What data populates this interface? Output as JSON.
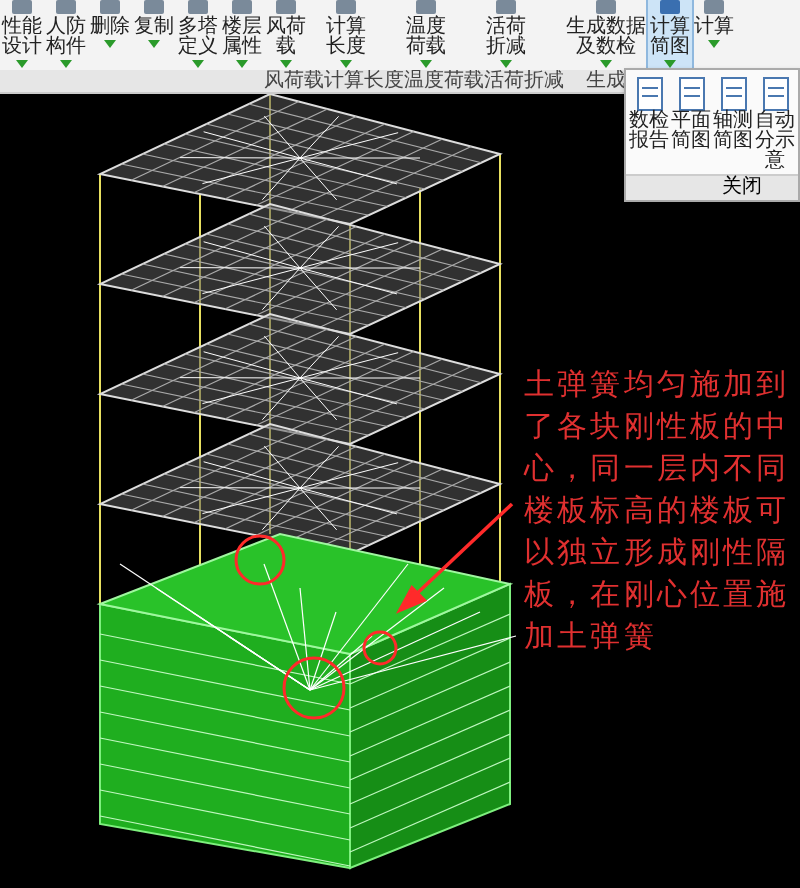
{
  "ribbon": {
    "groups": [
      {
        "items": [
          {
            "label": "性能设计",
            "selected": false
          },
          {
            "label": "人防构件",
            "selected": false
          },
          {
            "label": "删除",
            "selected": false
          },
          {
            "label": "复制",
            "selected": false
          },
          {
            "label": "多塔定义",
            "selected": false
          },
          {
            "label": "楼层属性",
            "selected": false
          }
        ]
      },
      {
        "label": "风荷载",
        "items": [
          {
            "label": "风荷载",
            "selected": false
          }
        ]
      },
      {
        "label": "计算长度",
        "items": [
          {
            "label": "计算长度",
            "selected": false
          }
        ]
      },
      {
        "label": "温度荷载",
        "items": [
          {
            "label": "温度荷载",
            "selected": false
          }
        ]
      },
      {
        "label": "活荷折减",
        "items": [
          {
            "label": "活荷折减",
            "selected": false
          }
        ]
      },
      {
        "label": "生成",
        "items": [
          {
            "label": "生成数据及数检",
            "selected": false
          }
        ]
      },
      {
        "items": [
          {
            "label": "计算简图",
            "selected": true
          },
          {
            "label": "计算",
            "selected": false
          }
        ]
      }
    ]
  },
  "dropdown": {
    "items": [
      {
        "label": "数检报告"
      },
      {
        "label": "平面简图"
      },
      {
        "label": "轴测简图"
      },
      {
        "label": "自动分示意"
      }
    ],
    "footer": "关闭"
  },
  "annotation": "土弹簧均匀施加到了各块刚性板的中心，同一层内不同楼板标高的楼板可以独立形成刚性隔板，在刚心位置施加土弹簧"
}
